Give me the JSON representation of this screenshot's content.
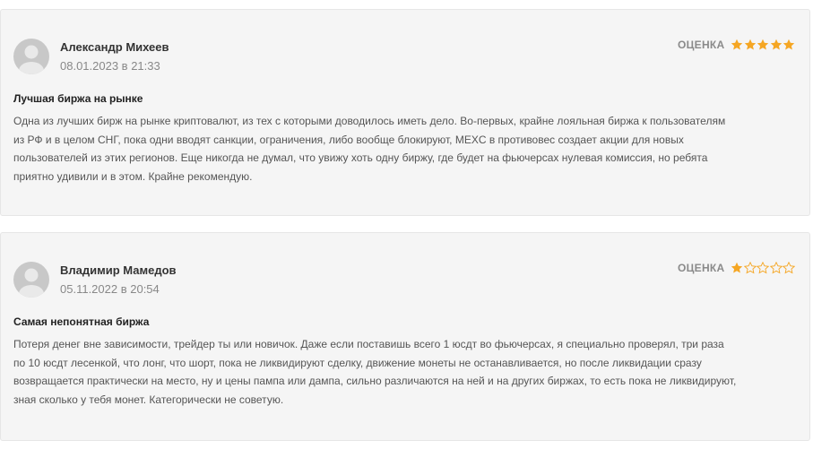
{
  "reviews": [
    {
      "author": "Александр Михеев",
      "date": "08.01.2023 в 21:33",
      "rating_label": "ОЦЕНКА",
      "rating": 5,
      "max_rating": 5,
      "title": "Лучшая биржа на рынке",
      "body_lines": [
        "Одна из лучших бирж на рынке криптовалют, из тех с которыми доводилось иметь дело. Во-первых, крайне лояльная биржа к пользователям",
        "из РФ и в целом СНГ, пока одни вводят санкции, ограничения, либо вообще блокируют, MEXC в противовес создает акции для новых",
        "пользователей из этих регионов. Еще никогда не думал, что увижу хоть одну биржу, где будет на фьючерсах нулевая комиссия, но ребята",
        "приятно удивили и в этом. Крайне рекомендую."
      ]
    },
    {
      "author": "Владимир Мамедов",
      "date": "05.11.2022 в 20:54",
      "rating_label": "ОЦЕНКА",
      "rating": 1,
      "max_rating": 5,
      "title": "Самая непонятная биржа",
      "body_lines": [
        "Потеря денег вне зависимости, трейдер ты или новичок. Даже если поставишь всего 1 юсдт во фьючерсах, я специально проверял, три раза",
        "по 10 юсдт лесенкой, что лонг, что шорт, пока не ликвидируют сделку, движение монеты не останавливается, но после ликвидации сразу",
        "возвращается практически на место, ну и цены пампа или дампа, сильно различаются на ней и на других биржах, то есть пока не ликвидируют,",
        "зная сколько у тебя монет. Категорически не советую."
      ]
    }
  ],
  "colors": {
    "star_filled": "#f5a623",
    "star_empty_outline": "#f5a623",
    "card_background": "#f5f5f5",
    "avatar": "#c8c8c8"
  },
  "icons": {
    "avatar": "user-silhouette-icon",
    "star": "star-icon"
  }
}
